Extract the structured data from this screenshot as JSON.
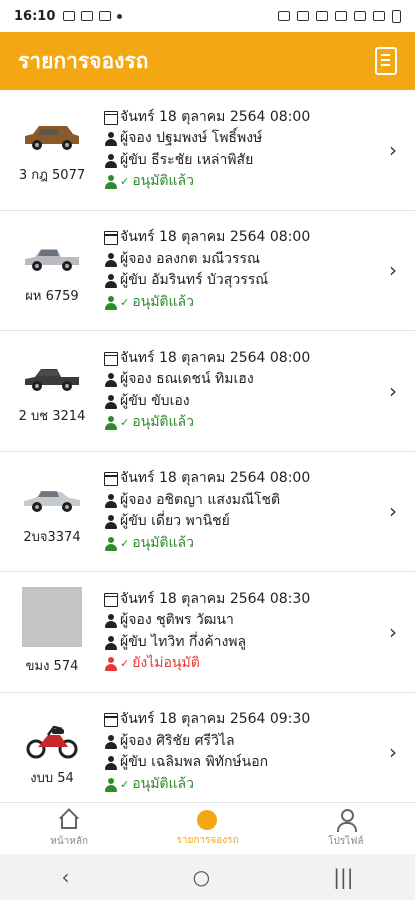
{
  "status_bar": {
    "time": "16:10",
    "left_icons": [
      "image-icon",
      "message-icon",
      "cast-icon",
      "dot-icon"
    ],
    "right_icons": [
      "alarm-icon",
      "bluetooth-icon",
      "mute-icon",
      "wifi-icon",
      "signal-icon",
      "signal-icon",
      "battery-icon"
    ]
  },
  "app_bar": {
    "title": "รายการจองรถ",
    "action_icon": "document-icon"
  },
  "colors": {
    "accent": "#f3a712",
    "approved": "#2e8b2e",
    "pending": "#e53935"
  },
  "bookings": [
    {
      "plate": "3 กฎ 5077",
      "vehicle": "suv-brown",
      "date": "จันทร์ 18 ตุลาคม 2564 08:00",
      "booker": "ผู้จอง ปฐมพงษ์ โพธิ์พงษ์",
      "driver": "ผู้ขับ ธีระชัย เหล่าพิสัย",
      "status": "อนุมัติแล้ว",
      "approved": true
    },
    {
      "plate": "ผห 6759",
      "vehicle": "pickup-silver",
      "date": "จันทร์ 18 ตุลาคม 2564 08:00",
      "booker": "ผู้จอง อลงกต มณีวรรณ",
      "driver": "ผู้ขับ อัมรินทร์ บัวสุวรรณ์",
      "status": "อนุมัติแล้ว",
      "approved": true
    },
    {
      "plate": "2 บช 3214",
      "vehicle": "pickup-dark",
      "date": "จันทร์ 18 ตุลาคม 2564 08:00",
      "booker": "ผู้จอง ธณเดชน์ ทิมเฮง",
      "driver": "ผู้ขับ ขับเอง",
      "status": "อนุมัติแล้ว",
      "approved": true
    },
    {
      "plate": "2บจ3374",
      "vehicle": "sedan-silver",
      "date": "จันทร์ 18 ตุลาคม 2564 08:00",
      "booker": "ผู้จอง อชิตญา แสงมณีโชติ",
      "driver": "ผู้ขับ เดี่ยว พานิชย์",
      "status": "อนุมัติแล้ว",
      "approved": true
    },
    {
      "plate": "ขมง 574",
      "vehicle": "placeholder",
      "date": "จันทร์ 18 ตุลาคม 2564 08:30",
      "booker": "ผู้จอง ชุติพร วัฒนา",
      "driver": "ผู้ขับ ไทวิท กึ่งค้างพลู",
      "status": "ยังไม่อนุมัติ",
      "approved": false
    },
    {
      "plate": "งบบ 54",
      "vehicle": "motorcycle-red",
      "date": "จันทร์ 18 ตุลาคม 2564 09:30",
      "booker": "ผู้จอง ศิริชัย ศรีวิไล",
      "driver": "ผู้ขับ เฉลิมพล พิทักษ์นอก",
      "status": "อนุมัติแล้ว",
      "approved": true
    }
  ],
  "bottom_nav": [
    {
      "label": "หน้าหลัก",
      "icon": "home-icon",
      "active": false
    },
    {
      "label": "รายการจองรถ",
      "icon": "booking-icon",
      "active": true
    },
    {
      "label": "โปรไฟล์",
      "icon": "profile-icon",
      "active": false
    }
  ],
  "system_nav": {
    "back": "‹",
    "home": "○",
    "recents": "|||"
  }
}
